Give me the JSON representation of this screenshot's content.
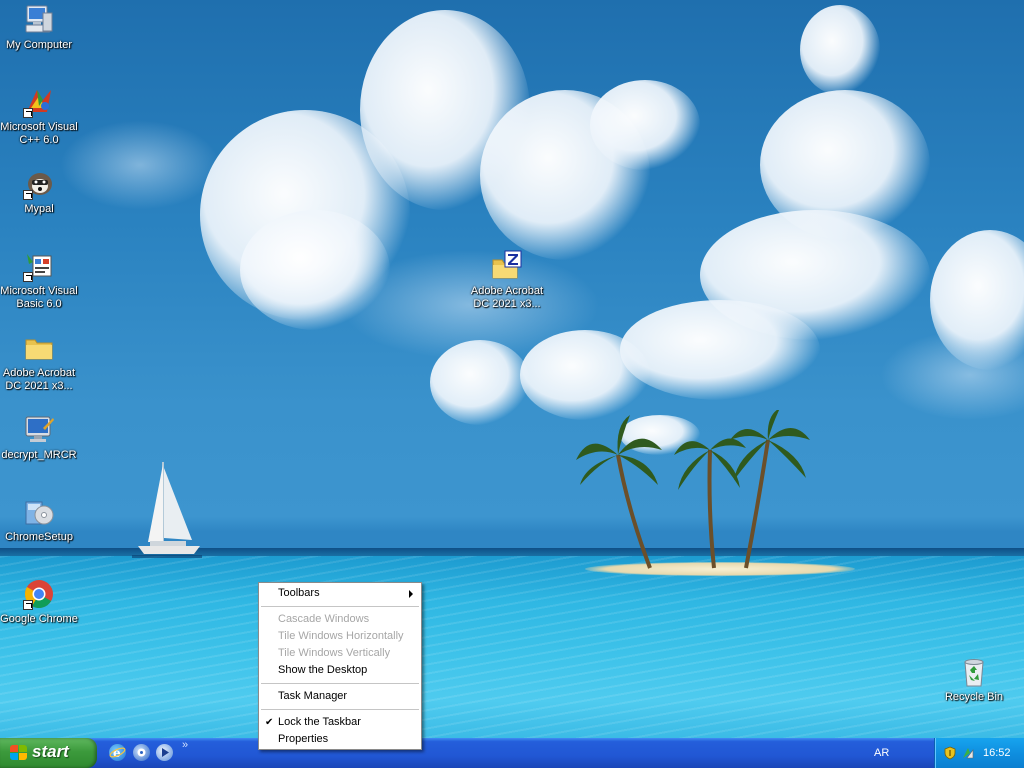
{
  "desktop_icons": [
    {
      "label": "My Computer",
      "icon": "my-computer-icon"
    },
    {
      "label": "Microsoft Visual C++ 6.0",
      "icon": "visual-cpp-icon"
    },
    {
      "label": "Mypal",
      "icon": "mypal-browser-icon"
    },
    {
      "label": "Microsoft Visual Basic 6.0",
      "icon": "visual-basic-icon"
    },
    {
      "label": "Adobe Acrobat DC 2021 x3...",
      "icon": "folder-icon"
    },
    {
      "label": "decrypt_MRCR",
      "icon": "monitor-program-icon"
    },
    {
      "label": "ChromeSetup",
      "icon": "installer-icon"
    },
    {
      "label": "Google Chrome",
      "icon": "chrome-icon"
    },
    {
      "label": "Adobe Acrobat DC 2021 x3...",
      "icon": "winzip-folder-icon"
    },
    {
      "label": "Recycle Bin",
      "icon": "recycle-bin-icon"
    }
  ],
  "context_menu": {
    "toolbars": "Toolbars",
    "cascade": "Cascade Windows",
    "tile_h": "Tile Windows Horizontally",
    "tile_v": "Tile Windows Vertically",
    "show_desktop": "Show the Desktop",
    "task_manager": "Task Manager",
    "lock_taskbar": "Lock the Taskbar",
    "lock_checked": true,
    "properties": "Properties"
  },
  "taskbar": {
    "start_label": "start",
    "quick_launch": [
      "internet-explorer-icon",
      "media-player-icon",
      "show-desktop-icon"
    ],
    "overflow_chevron": "»",
    "language": "AR",
    "tray_icons": [
      "security-shield-icon",
      "network-icon"
    ],
    "clock": "16:52"
  },
  "colors": {
    "taskbar_blue": "#245edb",
    "start_green": "#3c9a3c",
    "tray_blue": "#0f8fe0"
  }
}
